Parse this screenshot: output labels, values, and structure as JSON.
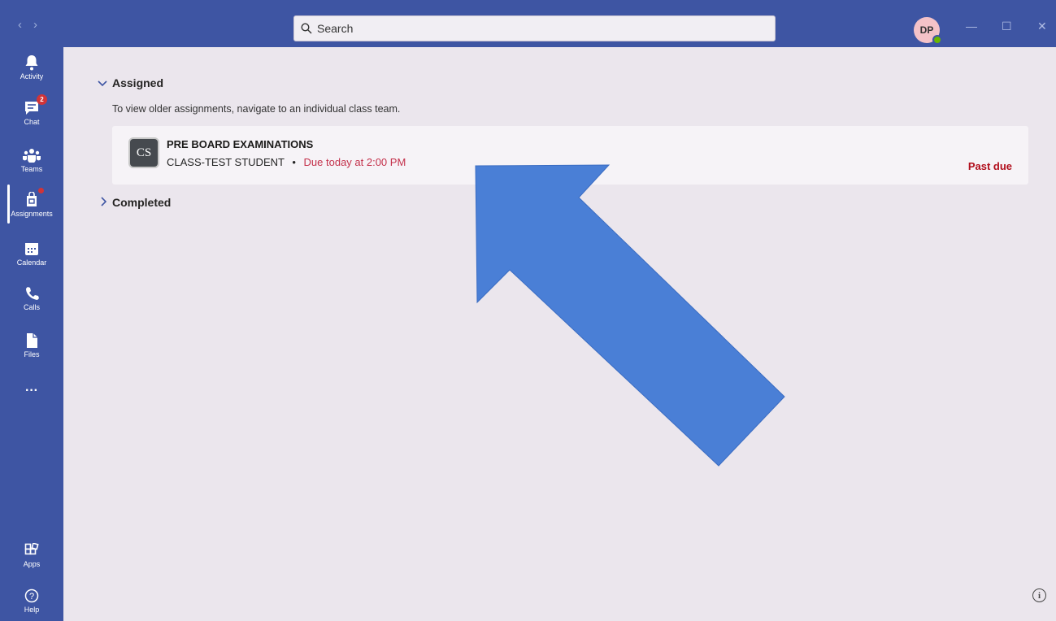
{
  "titlebar": {
    "back_glyph": "‹",
    "forward_glyph": "›",
    "search_placeholder": "Search",
    "avatar_initials": "DP",
    "minimize_glyph": "—",
    "maximize_glyph": "☐",
    "close_glyph": "✕"
  },
  "rail": {
    "items": [
      {
        "label": "Activity",
        "icon": "bell-icon"
      },
      {
        "label": "Chat",
        "icon": "chat-icon",
        "badge": "2"
      },
      {
        "label": "Teams",
        "icon": "teams-icon"
      },
      {
        "label": "Assignments",
        "icon": "assignments-icon"
      },
      {
        "label": "Calendar",
        "icon": "calendar-icon"
      },
      {
        "label": "Calls",
        "icon": "phone-icon"
      },
      {
        "label": "Files",
        "icon": "file-icon"
      },
      {
        "label": "Apps",
        "icon": "apps-icon"
      },
      {
        "label": "Help",
        "icon": "help-icon"
      }
    ],
    "more_glyph": "···"
  },
  "main": {
    "assigned_label": "Assigned",
    "hint_text": "To view older assignments, navigate to an individual class team.",
    "assignment": {
      "icon_text": "CS",
      "title": "PRE BOARD EXAMINATIONS",
      "class_name": "CLASS-TEST STUDENT",
      "separator": "•",
      "due_text": "Due today at 2:00 PM",
      "status": "Past due"
    },
    "completed_label": "Completed",
    "info_glyph": "i"
  },
  "colors": {
    "rail": "#3e55a3",
    "background": "#ebe6ed",
    "due": "#c4314b",
    "status": "#b10e1c",
    "annotation_arrow": "#4a7fd6"
  }
}
